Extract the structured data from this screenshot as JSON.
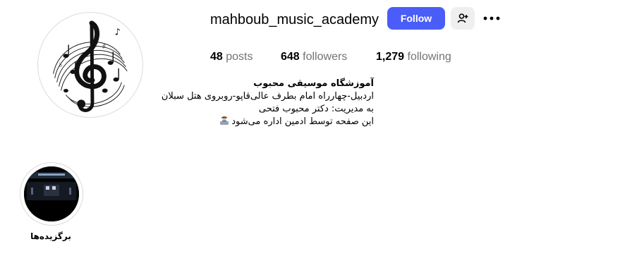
{
  "profile": {
    "username": "mahboub_music_academy",
    "follow_label": "Follow",
    "suggest_icon": "person-add-icon",
    "more_icon": "more-options-icon",
    "avatar_icon": "treble-clef-logo"
  },
  "stats": {
    "posts_count": "48",
    "posts_label": "posts",
    "followers_count": "648",
    "followers_label": "followers",
    "following_count": "1,279",
    "following_label": "following"
  },
  "bio": {
    "name": "آموزشگاه موسیقی محبوب",
    "line1": "اردبیل-چهارراه امام بطرف عالی‌قاپو-روبروی هتل سبلان",
    "line2": "به مدیریت: دکتر محبوب فتحی",
    "line3": "این صفحه توسط ادمین اداره می‌شود",
    "line3_emoji_icon": "man-technologist-emoji-icon"
  },
  "highlights": [
    {
      "label": "برگزیده‌ها",
      "cover_icon": "stage-performance-thumbnail"
    }
  ],
  "colors": {
    "follow_button": "#4a5df9",
    "secondary_button": "#efefef",
    "muted_text": "#737373"
  }
}
